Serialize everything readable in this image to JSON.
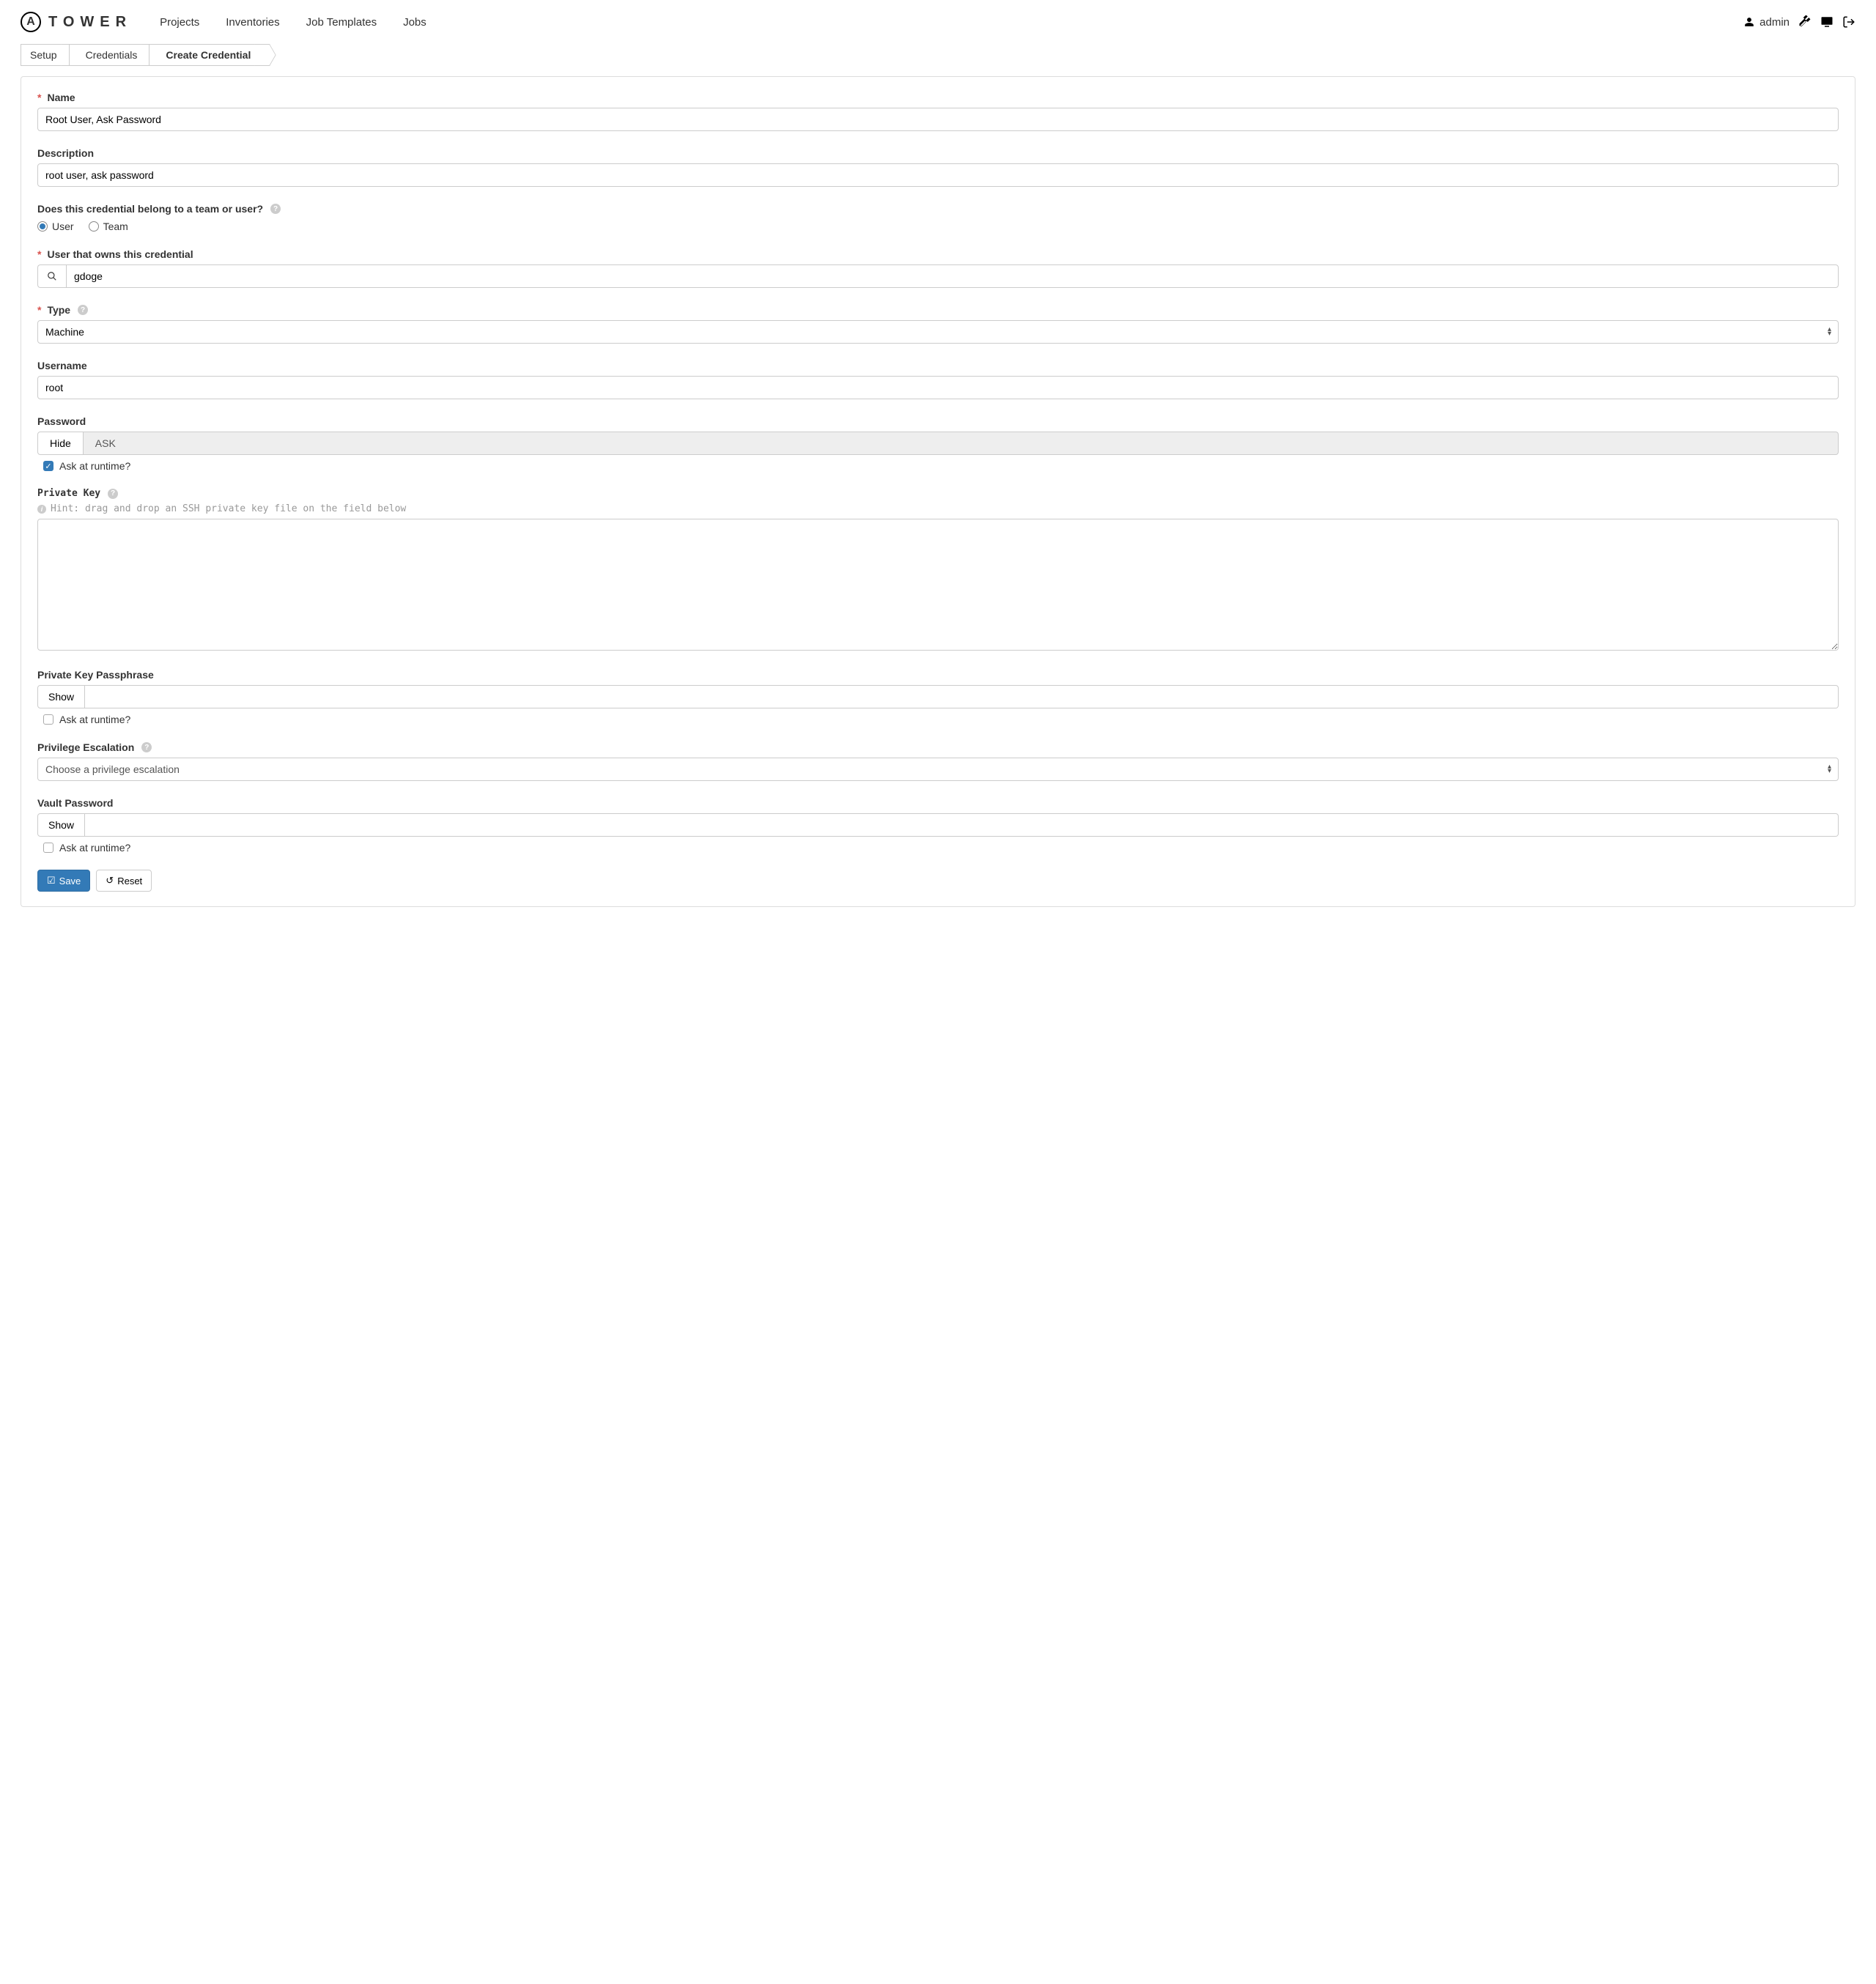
{
  "header": {
    "logo_text": "TOWER",
    "nav": {
      "projects": "Projects",
      "inventories": "Inventories",
      "job_templates": "Job Templates",
      "jobs": "Jobs"
    },
    "user": "admin"
  },
  "breadcrumb": {
    "setup": "Setup",
    "credentials": "Credentials",
    "create": "Create Credential"
  },
  "form": {
    "name": {
      "label": "Name",
      "value": "Root User, Ask Password"
    },
    "description": {
      "label": "Description",
      "value": "root user, ask password"
    },
    "owner": {
      "label": "Does this credential belong to a team or user?",
      "options": {
        "user": "User",
        "team": "Team"
      },
      "selected": "user"
    },
    "user_owner": {
      "label": "User that owns this credential",
      "value": "gdoge"
    },
    "type": {
      "label": "Type",
      "value": "Machine"
    },
    "username": {
      "label": "Username",
      "value": "root"
    },
    "password": {
      "label": "Password",
      "hide_btn": "Hide",
      "ask_btn": "ASK",
      "ask_label": "Ask at runtime?",
      "ask_checked": true
    },
    "private_key": {
      "label": "Private Key",
      "hint": "Hint: drag and drop an SSH private key file on the field below"
    },
    "passphrase": {
      "label": "Private Key Passphrase",
      "show_btn": "Show",
      "ask_label": "Ask at runtime?",
      "ask_checked": false
    },
    "priv_esc": {
      "label": "Privilege Escalation",
      "placeholder": "Choose a privilege escalation"
    },
    "vault": {
      "label": "Vault Password",
      "show_btn": "Show",
      "ask_label": "Ask at runtime?",
      "ask_checked": false
    },
    "actions": {
      "save": "Save",
      "reset": "Reset"
    }
  }
}
